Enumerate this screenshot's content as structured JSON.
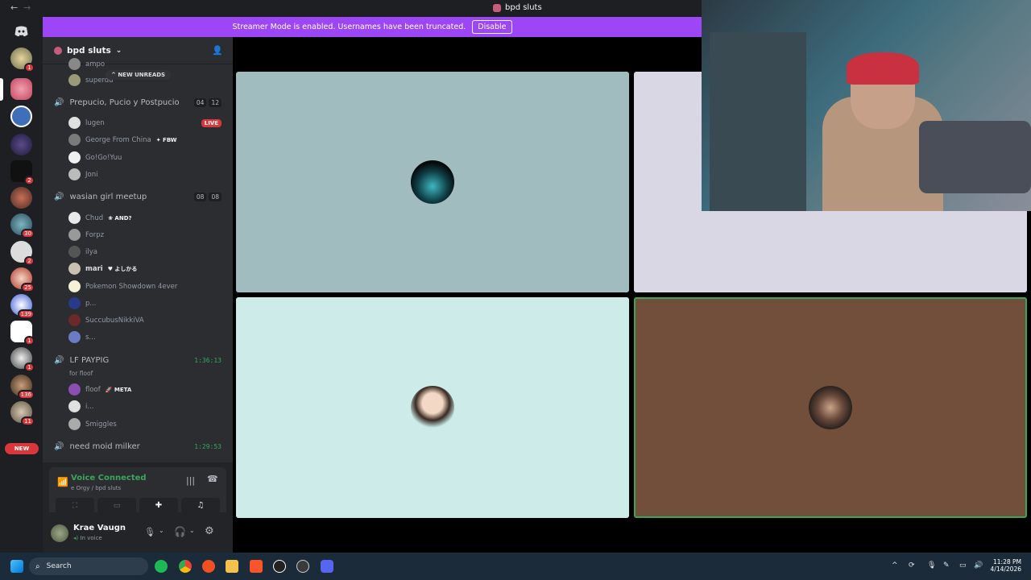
{
  "titlebar": {
    "back": "←",
    "forward": "→",
    "title": "bpd sluts"
  },
  "banner": {
    "message": "Streamer Mode is enabled. Usernames have been truncated.",
    "button": "Disable"
  },
  "guilds": {
    "home_icon": "discord-logo-icon",
    "badges": [
      "1",
      "",
      "",
      "2",
      "",
      "30",
      "2",
      "25",
      "139",
      "1",
      "1",
      "136",
      "11"
    ],
    "new_label": "NEW",
    "accent": "#da373c"
  },
  "server": {
    "name": "bpd sluts",
    "chevron": "⌄"
  },
  "unreads": {
    "label": "NEW UNREADS"
  },
  "top_users": [
    "ampo",
    "superdu"
  ],
  "channels": [
    {
      "name": "Prepucio, Pucio y Postpucio",
      "counts": [
        "04",
        "12"
      ],
      "users": [
        {
          "name": "lugen",
          "live": "LIVE"
        },
        {
          "name": "George From China",
          "tag": "FBW"
        },
        {
          "name": "Go!Go!Yuu"
        },
        {
          "name": "Joni"
        }
      ]
    },
    {
      "name": "wasian girl meetup",
      "counts": [
        "08",
        "08"
      ],
      "users": [
        {
          "name": "Chud",
          "tag": "AND?"
        },
        {
          "name": "Forpz"
        },
        {
          "name": "ilya"
        },
        {
          "name": "mari",
          "tag": "よしかる"
        },
        {
          "name": "Pokemon Showdown 4ever"
        },
        {
          "name": "p..."
        },
        {
          "name": "SuccubusNikkiVA"
        },
        {
          "name": "s..."
        }
      ]
    },
    {
      "name": "LF PAYPIG",
      "timer": "1:36:13",
      "sub": "for floof",
      "users": [
        {
          "name": "floof",
          "tag": "META"
        },
        {
          "name": "i..."
        },
        {
          "name": "Smiggles"
        }
      ]
    },
    {
      "name": "need moid milker",
      "timer": "1:29:53"
    }
  ],
  "voice": {
    "status": "Voice Connected",
    "path": "e Orgy / bpd sluts"
  },
  "account": {
    "name": "Krae Vaugn",
    "status": "In voice"
  },
  "tiles": [
    {
      "color": "#a1bcbf"
    },
    {
      "color": "#d9d7e3"
    },
    {
      "color": "#cdebe8"
    },
    {
      "color": "#724f3b"
    }
  ],
  "taskbar": {
    "search": "Search",
    "time": "11:28 PM",
    "date": "4/14/2026",
    "tray_caret": "^"
  }
}
